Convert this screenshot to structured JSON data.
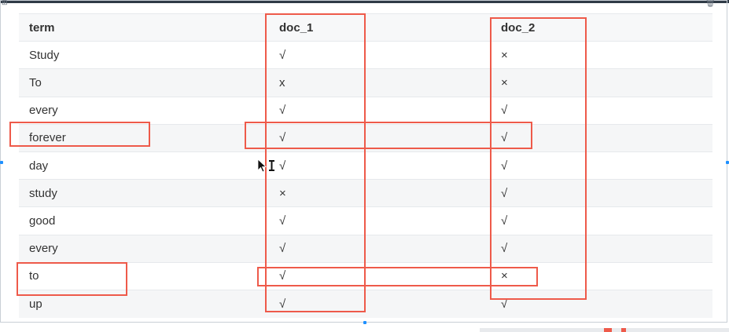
{
  "table": {
    "headers": [
      "term",
      "doc_1",
      "doc_2"
    ],
    "rows": [
      [
        "Study",
        "√",
        "×"
      ],
      [
        "To",
        "x",
        "×"
      ],
      [
        "every",
        "√",
        "√"
      ],
      [
        "forever",
        "√",
        "√"
      ],
      [
        "day",
        "√",
        "√"
      ],
      [
        "study",
        "×",
        "√"
      ],
      [
        "good",
        "√",
        "√"
      ],
      [
        "every",
        "√",
        "√"
      ],
      [
        "to",
        "√",
        "×"
      ],
      [
        "up",
        "√",
        "√"
      ]
    ]
  },
  "colors": {
    "annotation": "#ee5a4a",
    "selection_handle": "#1e90ff",
    "stripe": "#f5f6f7"
  },
  "icons": {
    "top_left": "grid-icon",
    "top_right": "trash-icon",
    "pointer": "cursor-icon"
  }
}
